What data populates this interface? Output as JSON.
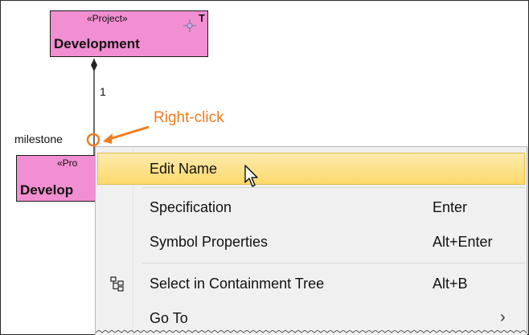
{
  "diagram": {
    "top_block": {
      "stereotype": "«Project»",
      "name": "Development",
      "corner_mark": "T"
    },
    "multiplicity": "1",
    "role_label": "milestone",
    "lower_block": {
      "stereotype": "«Pro",
      "name": "Develop"
    },
    "callout": {
      "text": "Right-click",
      "color": "#f07c1e"
    },
    "block_fill": "#f28fd2"
  },
  "context_menu": {
    "items": [
      {
        "label": "Edit Name",
        "shortcut": "",
        "highlighted": true
      },
      {
        "label": "Specification",
        "shortcut": "Enter"
      },
      {
        "label": "Symbol Properties",
        "shortcut": "Alt+Enter"
      },
      {
        "label": "Select in Containment Tree",
        "shortcut": "Alt+B",
        "icon": "containment-tree-icon"
      },
      {
        "label": "Go To",
        "submenu_arrow": "›"
      }
    ],
    "highlight_color": "#fbd96a"
  },
  "icons": [
    "pin-icon",
    "containment-tree-icon",
    "mouse-pointer-icon",
    "submenu-arrow-icon"
  ]
}
